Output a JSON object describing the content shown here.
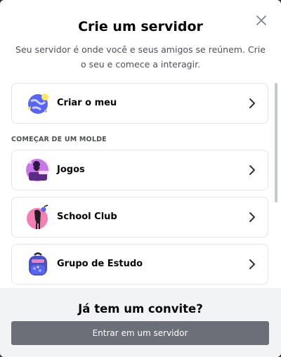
{
  "modal": {
    "title": "Crie um servidor",
    "subtitle": "Seu servidor é onde você e seus amigos se reúnem. Crie o seu e comece a interagir.",
    "close_icon": "close-icon"
  },
  "create_own": {
    "label": "Criar o meu",
    "icon": "globe-icon"
  },
  "templates_section": {
    "label": "COMEÇAR DE UM MOLDE",
    "items": [
      {
        "label": "Jogos",
        "icon": "gaming-icon"
      },
      {
        "label": "School Club",
        "icon": "school-club-icon"
      },
      {
        "label": "Grupo de Estudo",
        "icon": "backpack-icon"
      }
    ]
  },
  "footer": {
    "title": "Já tem um convite?",
    "join_label": "Entrar em um servidor"
  },
  "colors": {
    "button_bg": "#6d6f78",
    "footer_bg": "#f2f3f5",
    "text_primary": "#060607",
    "text_secondary": "#4e5058"
  }
}
